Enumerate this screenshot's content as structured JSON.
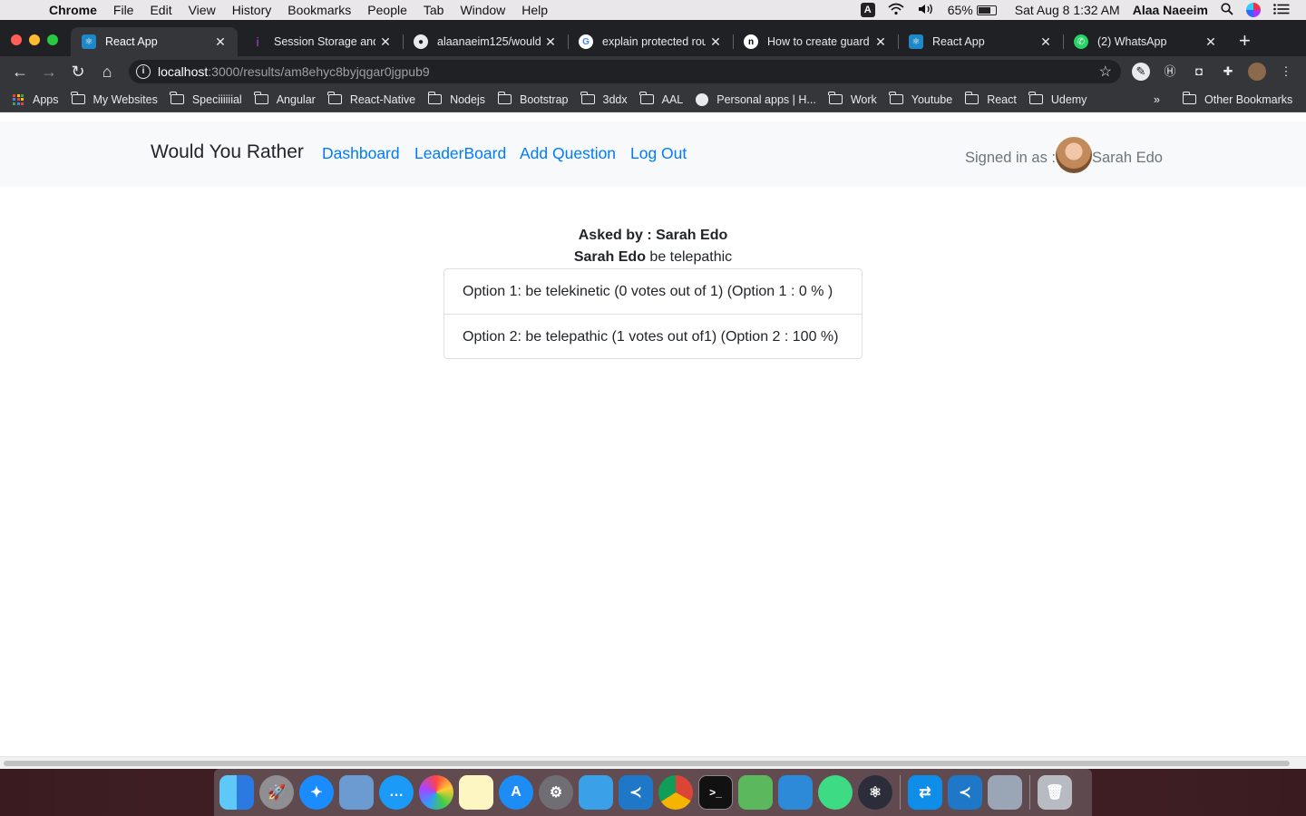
{
  "menubar": {
    "app_name": "Chrome",
    "items": [
      "File",
      "Edit",
      "View",
      "History",
      "Bookmarks",
      "People",
      "Tab",
      "Window",
      "Help"
    ],
    "input_source": "A",
    "battery_text": "65%",
    "battery_level": 0.65,
    "datetime": "Sat Aug 8  1:32 AM",
    "user": "Alaa Naeeim"
  },
  "tabs": [
    {
      "title": "React App",
      "favicon": "react-icon",
      "active": true
    },
    {
      "title": "Session Storage and",
      "favicon": "info-icon",
      "active": false
    },
    {
      "title": "alaanaeim125/would",
      "favicon": "github-icon",
      "active": false
    },
    {
      "title": "explain protected rou",
      "favicon": "google-icon",
      "active": false
    },
    {
      "title": "How to create guard",
      "favicon": "notion-icon",
      "active": false
    },
    {
      "title": "React App",
      "favicon": "react-icon",
      "active": false
    },
    {
      "title": "(2) WhatsApp",
      "favicon": "whatsapp-icon",
      "active": false
    }
  ],
  "address": {
    "host": "localhost",
    "path": ":3000/results/am8ehyc8byjqgar0jgpub9"
  },
  "bookmarks": {
    "apps": "Apps",
    "items": [
      "My Websites",
      "Speciiiiiial",
      "Angular",
      "React-Native",
      "Nodejs",
      "Bootstrap",
      "3ddx",
      "AAL",
      "Personal apps | H...",
      "Work",
      "Youtube",
      "React",
      "Udemy"
    ],
    "overflow": "»",
    "other": "Other Bookmarks"
  },
  "navbar": {
    "brand": "Would You Rather",
    "links": [
      "Dashboard",
      "LeaderBoard",
      "Add Question",
      "Log Out"
    ],
    "signed_in_label": "Signed in as :",
    "user_name": "Sarah Edo"
  },
  "result": {
    "asked_by": "Asked by : Sarah Edo",
    "answer_user": "Sarah Edo",
    "answer_text": " be telepathic",
    "options": [
      "Option 1: be telekinetic (0 votes out of 1) (Option 1 : 0 % )",
      "Option 2: be telepathic (1 votes out of1) (Option 2 : 100 %)"
    ]
  },
  "dock": {
    "apps": [
      "finder",
      "launchpad",
      "safari",
      "preview",
      "messages",
      "photos",
      "notes",
      "app-store",
      "system-preferences",
      "xcode-instruments",
      "vscode",
      "chrome",
      "terminal",
      "sourcetree",
      "xcode",
      "android-studio",
      "electron",
      "teamviewer",
      "vscode-insiders",
      "image-capture",
      "trash"
    ]
  }
}
